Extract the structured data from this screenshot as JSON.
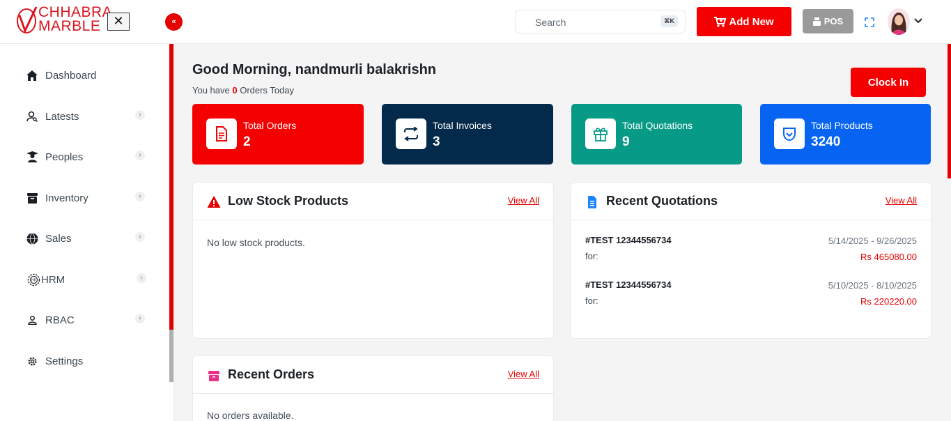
{
  "brand": {
    "line1": "CHHABRA",
    "line2": "MARBLE"
  },
  "header": {
    "close_glyph": "✕",
    "search_placeholder": "Search",
    "search_shortcut": "⌘K",
    "add_new_label": "Add New",
    "pos_label": "POS"
  },
  "sidebar": {
    "items": [
      {
        "label": "Dashboard",
        "icon": "home-icon",
        "has_submenu": false
      },
      {
        "label": "Latests",
        "icon": "user-search-icon",
        "has_submenu": true
      },
      {
        "label": "Peoples",
        "icon": "graduation-user-icon",
        "has_submenu": true
      },
      {
        "label": "Inventory",
        "icon": "archive-box-icon",
        "has_submenu": true
      },
      {
        "label": "Sales",
        "icon": "globe-icon",
        "has_submenu": true
      },
      {
        "label": "HRM",
        "icon": "hrm-gear-icon",
        "has_submenu": true
      },
      {
        "label": "RBAC",
        "icon": "person-icon",
        "has_submenu": true
      },
      {
        "label": "Settings",
        "icon": "gear-icon",
        "has_submenu": false
      }
    ]
  },
  "main": {
    "greeting": "Good Morning, nandmurli balakrishn",
    "sub_prefix": "You have ",
    "orders_today": "0",
    "sub_suffix": " Orders Today",
    "clock_in_label": "Clock In",
    "stats": [
      {
        "label": "Total Orders",
        "value": "2",
        "color": "#f40000",
        "icon": "document-icon",
        "icon_color": "#f40000"
      },
      {
        "label": "Total Invoices",
        "value": "3",
        "color": "#03294b",
        "icon": "swap-arrows-icon",
        "icon_color": "#03294b"
      },
      {
        "label": "Total Quotations",
        "value": "9",
        "color": "#079a87",
        "icon": "gift-icon",
        "icon_color": "#079a87"
      },
      {
        "label": "Total Products",
        "value": "3240",
        "color": "#0764f2",
        "icon": "shield-check-icon",
        "icon_color": "#0764f2"
      }
    ],
    "low_stock": {
      "title": "Low Stock Products",
      "view_all": "View All",
      "empty": "No low stock products."
    },
    "recent_quotations": {
      "title": "Recent Quotations",
      "view_all": "View All",
      "rows": [
        {
          "id": "#TEST 12344556734",
          "for": "for:",
          "dates": "5/14/2025 - 9/26/2025",
          "amount": "Rs 465080.00"
        },
        {
          "id": "#TEST 12344556734",
          "for": "for:",
          "dates": "5/10/2025 - 8/10/2025",
          "amount": "Rs 220220.00"
        }
      ]
    },
    "recent_orders": {
      "title": "Recent Orders",
      "view_all": "View All",
      "empty": "No orders available."
    }
  }
}
